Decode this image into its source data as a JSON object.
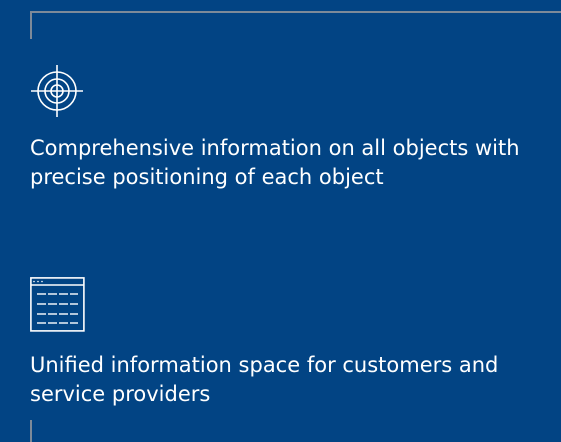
{
  "features": [
    {
      "icon": "target-icon",
      "text": "Comprehensive information on all objects with precise positioning of each object"
    },
    {
      "icon": "document-list-icon",
      "text": "Unified information space for customers and service providers"
    }
  ],
  "colors": {
    "background": "#024484",
    "text": "#ffffff",
    "frame": "#7d8a99"
  }
}
